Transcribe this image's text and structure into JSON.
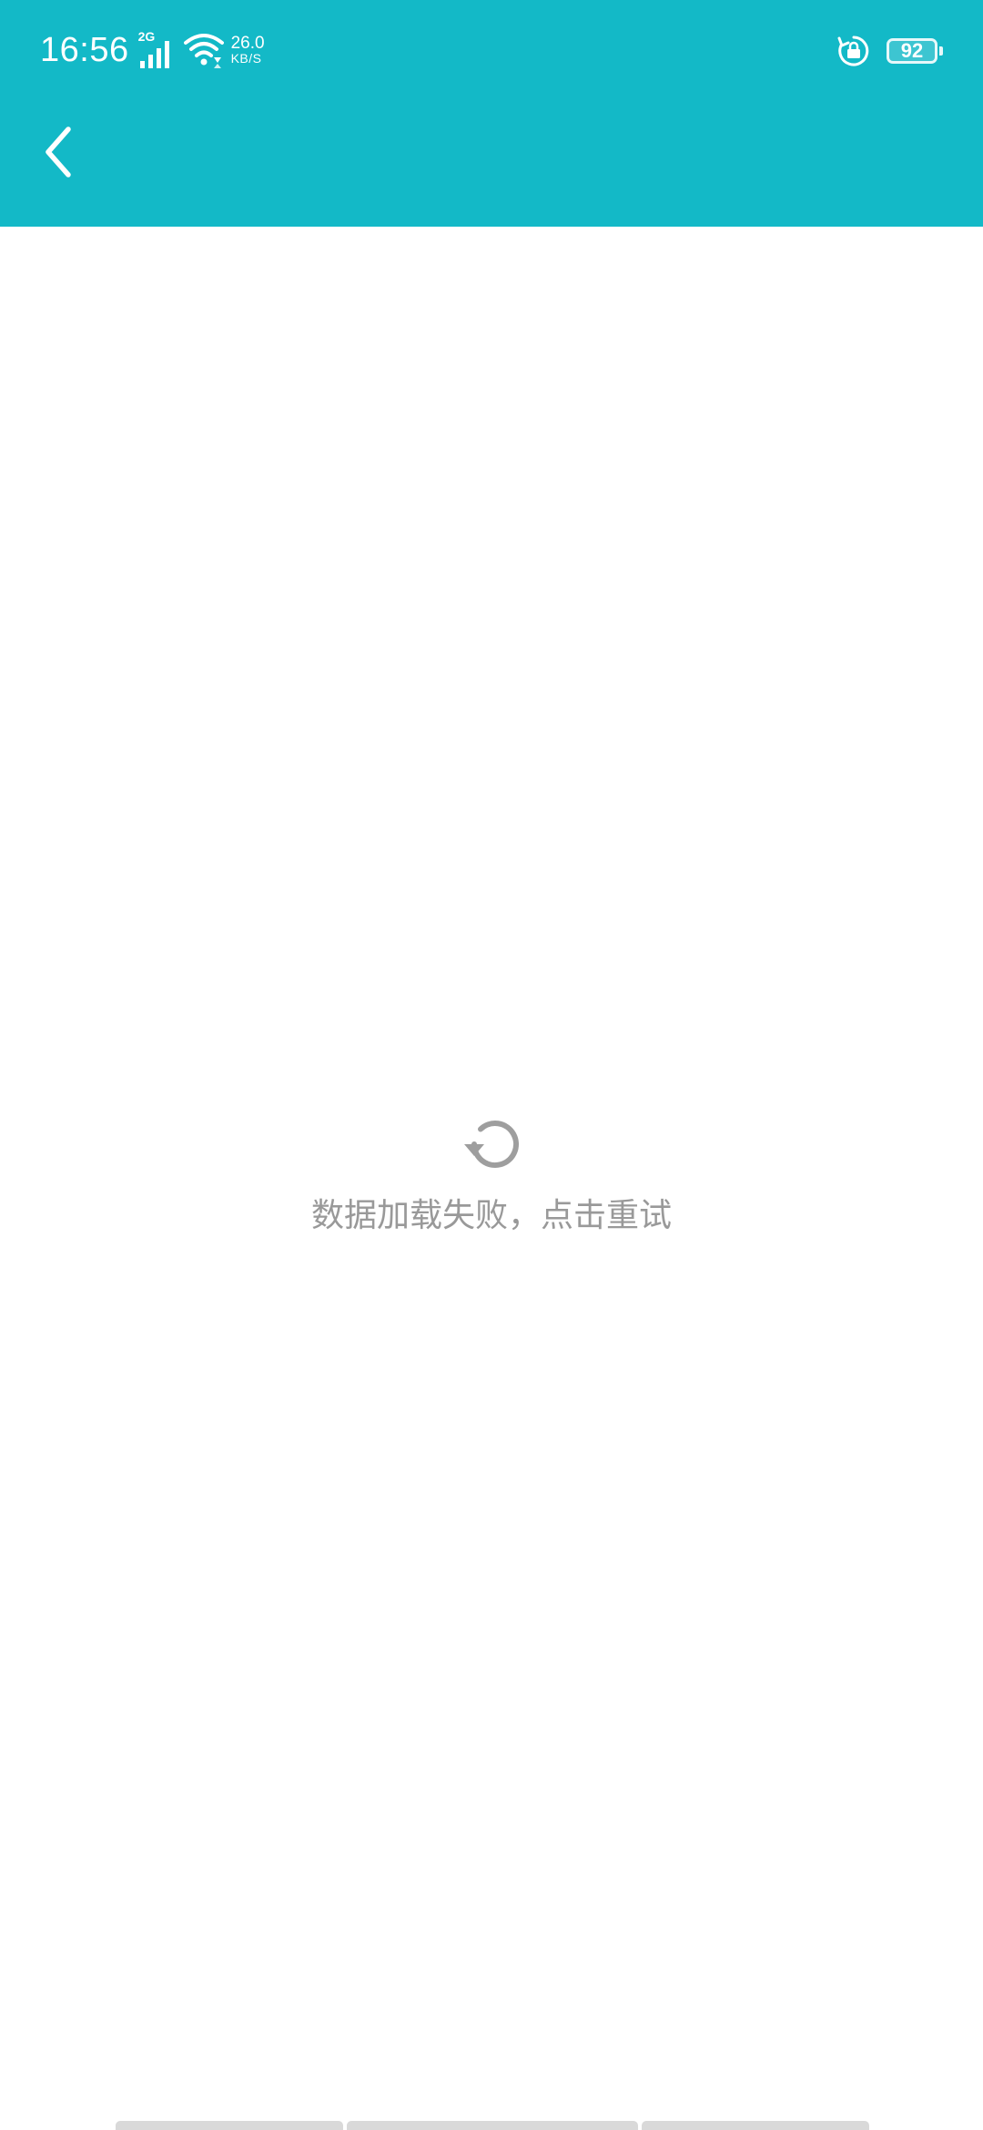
{
  "theme": {
    "primary": "#13b9c7",
    "background": "#ffffff",
    "muted_text": "#999999"
  },
  "status_bar": {
    "time": "16:56",
    "network_type": "2G",
    "speed_value": "26.0",
    "speed_unit": "KB/S",
    "battery_level": "92",
    "icons": [
      "signal-icon",
      "wifi-icon",
      "rotation-lock-icon",
      "battery-icon"
    ]
  },
  "app_bar": {
    "back_icon": "chevron-left-icon"
  },
  "error_state": {
    "icon": "refresh-icon",
    "message": "数据加载失败，点击重试"
  }
}
